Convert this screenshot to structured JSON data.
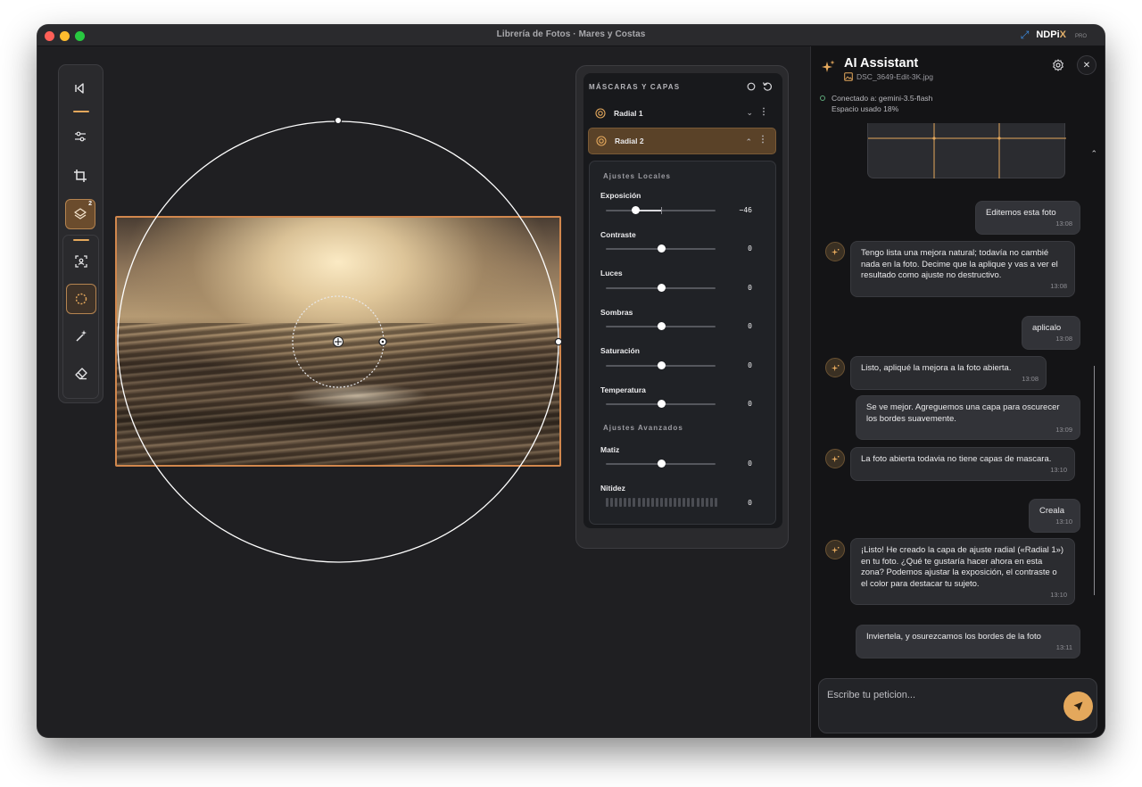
{
  "window": {
    "title": "Librería de Fotos · Mares y Costas",
    "brand": {
      "name": "NDPi",
      "name_accent": "X",
      "tier": "PRO"
    }
  },
  "toolbar": {
    "tools": [
      {
        "name": "pointer-tool-icon",
        "active": false
      },
      {
        "name": "adjust-sliders-icon",
        "active": false
      },
      {
        "name": "crop-icon",
        "active": false
      },
      {
        "name": "layers-icon",
        "active": true,
        "badge": "2"
      },
      {
        "name": "subject-select-icon",
        "active": false
      },
      {
        "name": "radial-mask-icon",
        "active": true
      },
      {
        "name": "magic-wand-icon",
        "active": false
      },
      {
        "name": "eraser-icon",
        "active": false
      }
    ]
  },
  "masks": {
    "title": "MÁSCARAS Y CAPAS",
    "layers": [
      {
        "name": "Radial 1",
        "expanded": false,
        "selected": false
      },
      {
        "name": "Radial 2",
        "expanded": true,
        "selected": true
      }
    ],
    "section_local": "Ajustes Locales",
    "section_advanced": "Ajustes Avanzados",
    "local": [
      {
        "label": "Exposición",
        "value": "−46",
        "position": 0.27
      },
      {
        "label": "Contraste",
        "value": "0",
        "position": 0.5
      },
      {
        "label": "Luces",
        "value": "0",
        "position": 0.5
      },
      {
        "label": "Sombras",
        "value": "0",
        "position": 0.5
      },
      {
        "label": "Saturación",
        "value": "0",
        "position": 0.5
      },
      {
        "label": "Temperatura",
        "value": "0",
        "position": 0.5
      }
    ],
    "advanced": [
      {
        "label": "Matiz",
        "value": "0",
        "position": 0.5
      },
      {
        "label": "Nitidez",
        "value": "0",
        "position": 0
      }
    ]
  },
  "assistant": {
    "title": "AI Assistant",
    "file": "DSC_3649-Edit-3K.jpg",
    "connected": "Conectado a: gemini-3.5-flash",
    "space": "Espacio usado 18%",
    "messages": [
      {
        "role": "user",
        "text": "Editemos esta foto",
        "time": "13:08"
      },
      {
        "role": "ai",
        "text": "Tengo lista una mejora natural; todavía no cambié nada en la foto. Decime que la aplique y vas a ver el resultado como ajuste no destructivo.",
        "time": "13:08"
      },
      {
        "role": "user",
        "text": "aplicalo",
        "time": "13:08"
      },
      {
        "role": "ai",
        "text": "Listo, apliqué la mejora a la foto abierta.",
        "time": "13:08"
      },
      {
        "role": "user",
        "text": "Se ve mejor. Agreguemos una capa para oscurecer los bordes suavemente.",
        "time": "13:09"
      },
      {
        "role": "ai",
        "text": "La foto abierta todavia no tiene capas de mascara.",
        "time": "13:10"
      },
      {
        "role": "user",
        "text": "Creala",
        "time": "13:10"
      },
      {
        "role": "ai",
        "text": "¡Listo! He creado la capa de ajuste radial («Radial 1») en tu foto. ¿Qué te gustaría hacer ahora en esta zona? Podemos ajustar la exposición, el contraste o el color para destacar tu sujeto.",
        "time": "13:10"
      },
      {
        "role": "user",
        "text": "Inviertela, y osurezcamos los bordes de la foto",
        "time": "13:11"
      }
    ],
    "composer_placeholder": "Escribe tu peticion..."
  },
  "colors": {
    "accent": "#e4a85c",
    "layer_selected": "#5a4228",
    "window_bg": "#1f1f22",
    "panel_bg": "#18191c"
  }
}
